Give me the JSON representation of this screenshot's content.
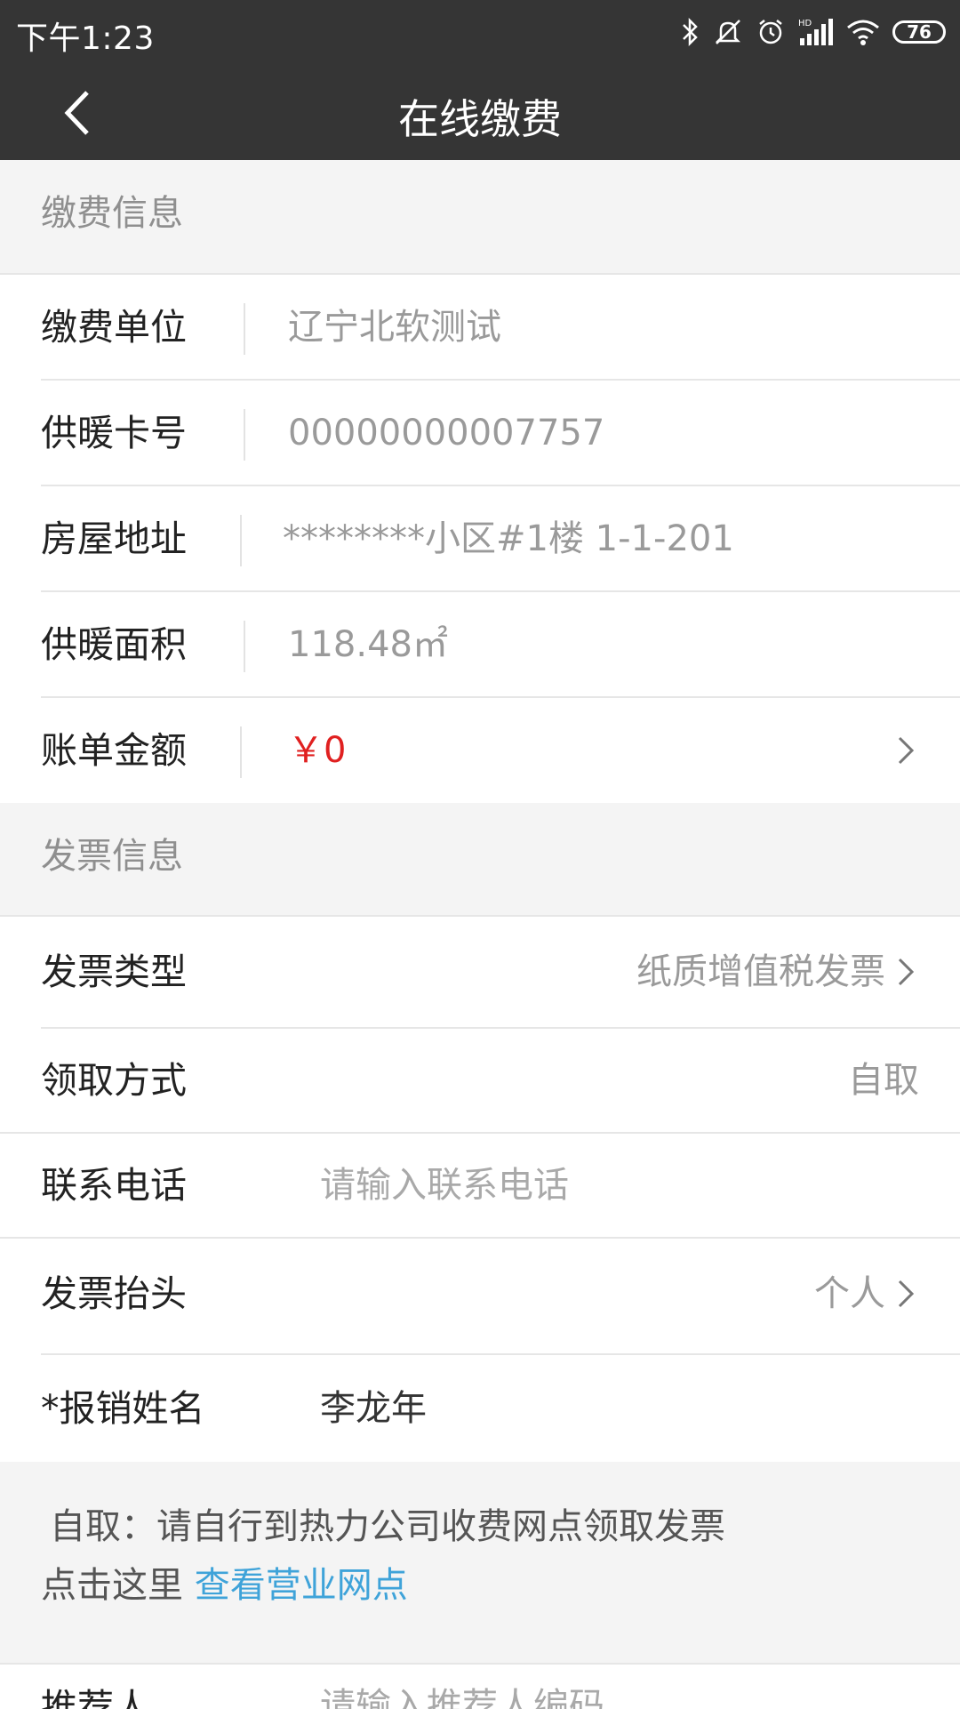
{
  "status_bar": {
    "time": "下午1:23",
    "battery": "76",
    "icons": [
      "bluetooth-icon",
      "mute-icon",
      "alarm-icon",
      "hd-signal-icon",
      "wifi-icon",
      "battery-icon"
    ]
  },
  "header": {
    "title": "在线缴费",
    "back_icon": "chevron-left-icon"
  },
  "payment_section": {
    "title": "缴费信息",
    "rows": [
      {
        "label": "缴费单位",
        "value": "辽宁北软测试"
      },
      {
        "label": "供暖卡号",
        "value": "00000000007757"
      },
      {
        "label": "房屋地址",
        "value": "********小区#1楼 1-1-201"
      },
      {
        "label": "供暖面积",
        "value": "118.48㎡"
      },
      {
        "label": "账单金额",
        "value": "￥0"
      }
    ]
  },
  "invoice_section": {
    "title": "发票信息",
    "type": {
      "label": "发票类型",
      "value": "纸质增值税发票"
    },
    "method": {
      "label": "领取方式",
      "value": "自取"
    },
    "phone": {
      "label": "联系电话",
      "placeholder": "请输入联系电话"
    },
    "heading": {
      "label": "发票抬头",
      "value": "个人"
    },
    "name": {
      "label": "*报销姓名",
      "value": "李龙年"
    }
  },
  "note": {
    "line1": "自取：请自行到热力公司收费网点领取发票",
    "line2_prefix": "点击这里 ",
    "link": "查看营业网点"
  },
  "referrer": {
    "label": "推荐人",
    "placeholder": "请输入推荐人编码"
  },
  "colors": {
    "header_bg": "#353535",
    "amount_red": "#e02020",
    "link_blue": "#3fa3d9",
    "page_bg": "#f4f4f4"
  }
}
